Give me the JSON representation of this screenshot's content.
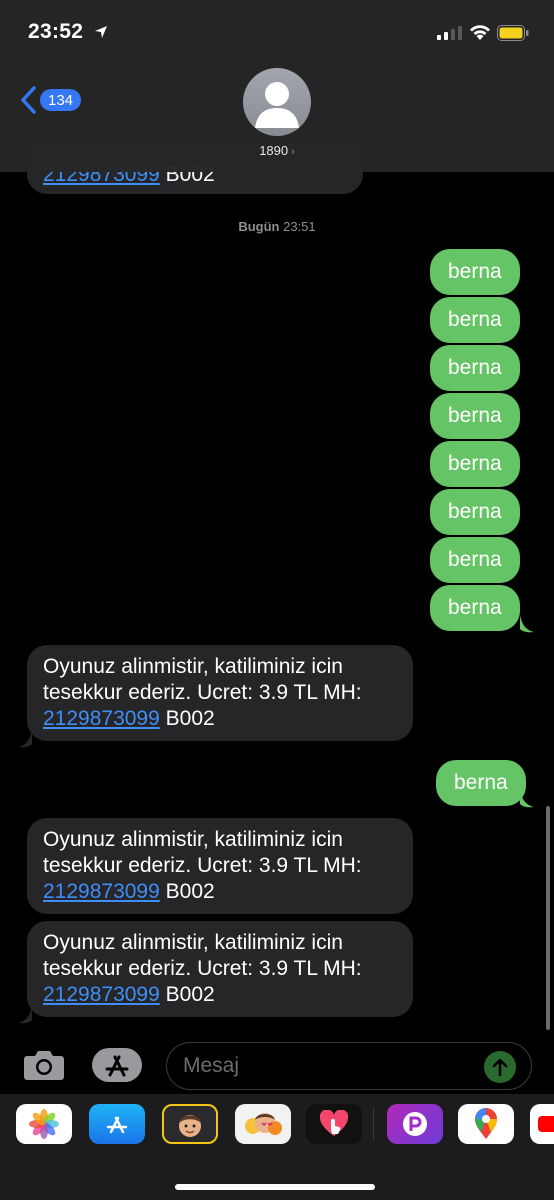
{
  "status": {
    "time": "23:52"
  },
  "header": {
    "back_count": "134",
    "contact": "1890"
  },
  "thread": {
    "timestamp_day": "Bugün",
    "timestamp_time": "23:51",
    "top_partial": {
      "link": "2129873099",
      "code": "B002"
    },
    "sent_text": "berna",
    "received": {
      "line1": "Oyunuz alinmistir, katiliminiz icin",
      "line2": "tesekkur ederiz. Ucret: 3.9 TL MH:",
      "link": "2129873099",
      "code": "B002"
    }
  },
  "input": {
    "placeholder": "Mesaj"
  },
  "drawer": {
    "icons": [
      "photos-icon",
      "app-store-icon",
      "memoji-icon",
      "memoji-stickers-icon",
      "digital-touch-icon",
      "picsart-icon",
      "google-maps-icon",
      "youtube-icon"
    ]
  },
  "colors": {
    "sent_bubble": "#65c466",
    "received_bubble": "#262628",
    "link": "#3e8ef7",
    "accent": "#3478f6"
  }
}
